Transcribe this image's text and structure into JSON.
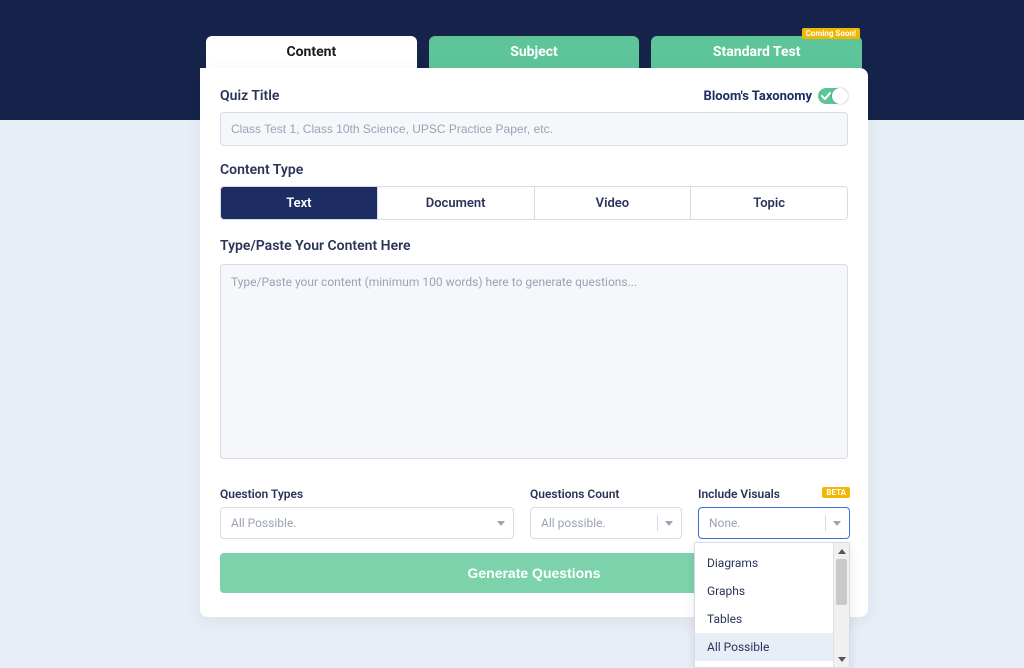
{
  "tabs": {
    "content": "Content",
    "subject": "Subject",
    "standard_test": "Standard Test",
    "coming_soon_badge": "Coming Soon!"
  },
  "form": {
    "quiz_title_label": "Quiz Title",
    "quiz_title_placeholder": "Class Test 1, Class 10th Science, UPSC Practice Paper, etc.",
    "blooms_label": "Bloom's Taxonomy",
    "content_type_label": "Content Type",
    "content_type_options": {
      "text": "Text",
      "document": "Document",
      "video": "Video",
      "topic": "Topic"
    },
    "content_label": "Type/Paste Your Content Here",
    "content_placeholder": "Type/Paste your content (minimum 100 words) here to generate questions..."
  },
  "options": {
    "question_types": {
      "label": "Question Types",
      "value": "All Possible."
    },
    "questions_count": {
      "label": "Questions Count",
      "value": "All possible."
    },
    "include_visuals": {
      "label": "Include Visuals",
      "value": "None.",
      "beta": "BETA"
    },
    "dropdown_items": [
      "Diagrams",
      "Graphs",
      "Tables",
      "All Possible"
    ]
  },
  "actions": {
    "generate": "Generate Questions"
  }
}
